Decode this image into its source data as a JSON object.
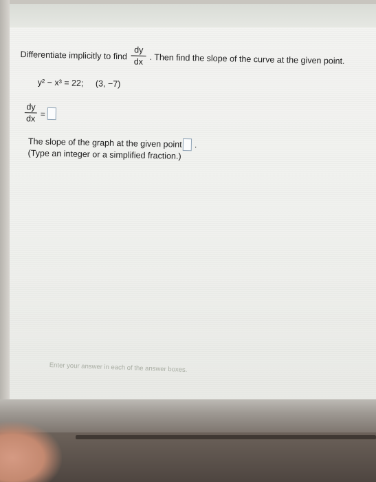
{
  "question": {
    "text_before": "Differentiate implicitly to find",
    "fraction_num": "dy",
    "fraction_den": "dx",
    "text_after": ". Then find the slope of the curve at the given point."
  },
  "equation": {
    "lhs": "y² − x³ = 22;",
    "point": "(3, −7)"
  },
  "answer_dydx": {
    "num": "dy",
    "den": "dx",
    "equals": "=",
    "value": ""
  },
  "slope": {
    "text": "The slope of the graph at the given point is",
    "value": "",
    "period": ".",
    "hint": "(Type an integer or a simplified fraction.)"
  },
  "footer": {
    "instruction": "Enter your answer in each of the answer boxes."
  }
}
